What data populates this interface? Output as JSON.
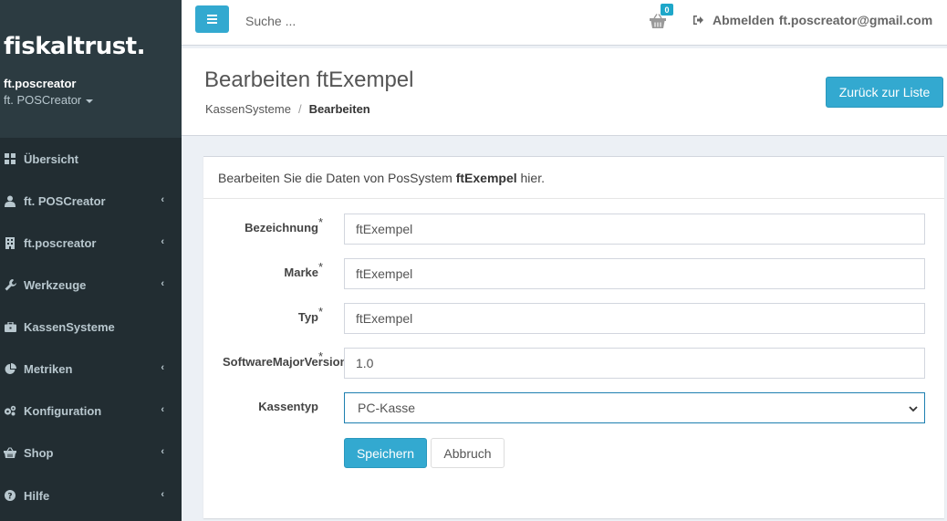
{
  "sidebar": {
    "logo": "fiskaltrust.",
    "user_name": "ft.poscreator",
    "user_org": "ft. POSCreator",
    "items": [
      {
        "label": "Übersicht",
        "icon": "dashboard-icon",
        "has_children": false
      },
      {
        "label": "ft. POSCreator",
        "icon": "user-icon",
        "has_children": true
      },
      {
        "label": "ft.poscreator",
        "icon": "building-icon",
        "has_children": true
      },
      {
        "label": "Werkzeuge",
        "icon": "wrench-icon",
        "has_children": true
      },
      {
        "label": "KassenSysteme",
        "icon": "briefcase-icon",
        "has_children": false
      },
      {
        "label": "Metriken",
        "icon": "pie-chart-icon",
        "has_children": true
      },
      {
        "label": "Konfiguration",
        "icon": "cogs-icon",
        "has_children": true
      },
      {
        "label": "Shop",
        "icon": "basket-icon",
        "has_children": true
      },
      {
        "label": "Hilfe",
        "icon": "question-icon",
        "has_children": true
      }
    ]
  },
  "topbar": {
    "search_placeholder": "Suche ...",
    "cart_count": "0",
    "logout_label": "Abmelden",
    "user_email": "ft.poscreator@gmail.com"
  },
  "header": {
    "title": "Bearbeiten ftExempel",
    "breadcrumb": [
      "KassenSysteme",
      "Bearbeiten"
    ],
    "back_button": "Zurück zur Liste"
  },
  "form": {
    "intro_prefix": "Bearbeiten Sie die Daten von PosSystem ",
    "intro_name": "ftExempel",
    "intro_suffix": " hier.",
    "fields": [
      {
        "label": "Bezeichnung",
        "required": true,
        "value": "ftExempel"
      },
      {
        "label": "Marke",
        "required": true,
        "value": "ftExempel"
      },
      {
        "label": "Typ",
        "required": true,
        "value": "ftExempel"
      },
      {
        "label": "SoftwareMajorVersion",
        "required": true,
        "value": "1.0"
      }
    ],
    "kassentyp_label": "Kassentyp",
    "kassentyp_value": "PC-Kasse",
    "save_label": "Speichern",
    "cancel_label": "Abbruch"
  },
  "colors": {
    "accent": "#33a9d0",
    "sidebar_dark": "#222d32",
    "sidebar_brand": "#2c3b41"
  }
}
